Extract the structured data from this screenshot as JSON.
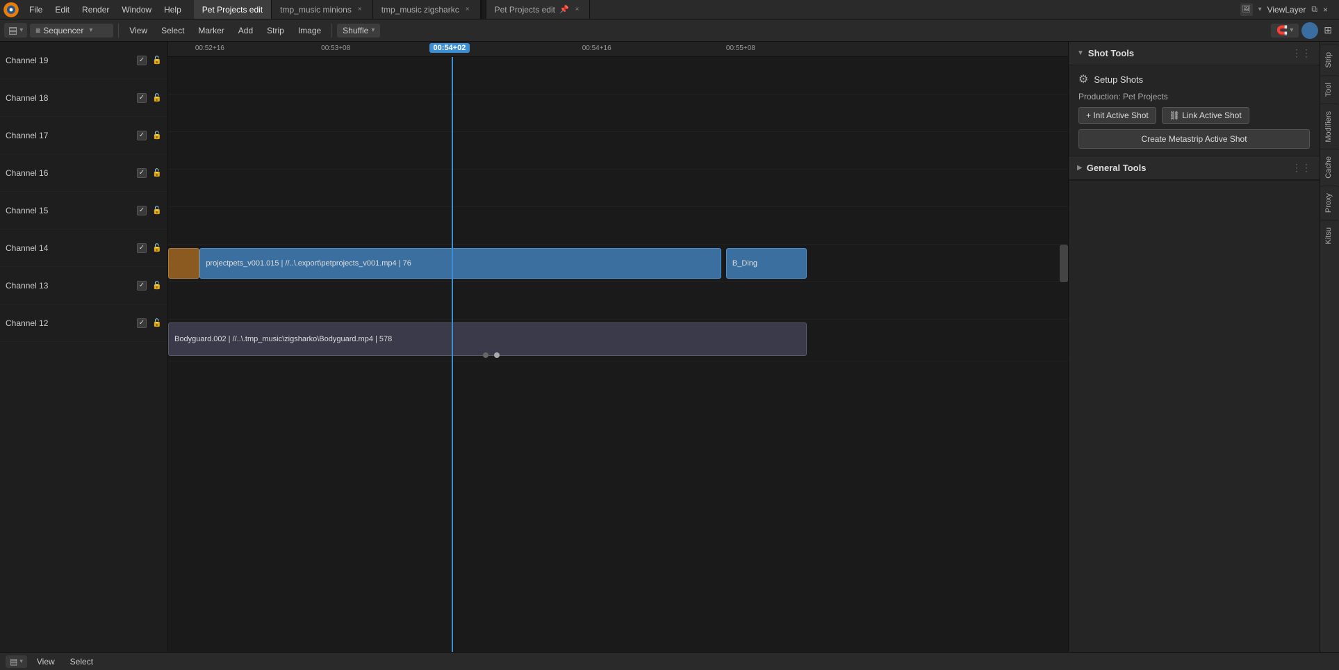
{
  "app": {
    "logo": "⬡",
    "menu": [
      "File",
      "Edit",
      "Render",
      "Window",
      "Help"
    ]
  },
  "tabs": [
    {
      "label": "Pet Projects edit",
      "active": true,
      "pinned": false
    },
    {
      "label": "tmp_music minions",
      "active": false,
      "pinned": false
    },
    {
      "label": "tmp_music zigsharkc",
      "active": false,
      "pinned": false
    },
    {
      "label": "Pet Projects edit",
      "active": false,
      "pinned": true,
      "separator": true
    }
  ],
  "viewlayer": {
    "label": "ViewLayer"
  },
  "toolbar": {
    "workspace_icon": "▤",
    "sequencer_label": "Sequencer",
    "view_label": "View",
    "select_label": "Select",
    "marker_label": "Marker",
    "add_label": "Add",
    "strip_label": "Strip",
    "image_label": "Image",
    "shuffle_label": "Shuffle",
    "shuffle_arrow": "▾"
  },
  "channels": [
    {
      "name": "Channel 19",
      "checked": true
    },
    {
      "name": "Channel 18",
      "checked": true
    },
    {
      "name": "Channel 17",
      "checked": true
    },
    {
      "name": "Channel 16",
      "checked": true
    },
    {
      "name": "Channel 15",
      "checked": true
    },
    {
      "name": "Channel 14",
      "checked": true
    },
    {
      "name": "Channel 13",
      "checked": true
    },
    {
      "name": "Channel 12",
      "checked": true
    }
  ],
  "timecodes": [
    {
      "label": "00:52+16",
      "left_pct": 3
    },
    {
      "label": "00:53+08",
      "left_pct": 17
    },
    {
      "label": "00:54+02",
      "left_pct": 30,
      "active": true
    },
    {
      "label": "00:54+16",
      "left_pct": 46
    },
    {
      "label": "00:55+08",
      "left_pct": 62
    }
  ],
  "playhead": {
    "time": "00:54+02",
    "left_pct": 30
  },
  "strips": [
    {
      "channel_index": 5,
      "type": "orange",
      "label": "",
      "left_pct": 0,
      "width_pct": 3.8
    },
    {
      "channel_index": 5,
      "type": "blue",
      "label": "projectpets_v001.015 | //..\\.export\\petprojects_v001.mp4 | 76",
      "left_pct": 3.8,
      "width_pct": 60
    },
    {
      "channel_index": 5,
      "type": "blue-right",
      "label": "B_Ding",
      "left_pct": 64.5,
      "width_pct": 10
    },
    {
      "channel_index": 7,
      "type": "gray",
      "label": "Bodyguard.002 | //..\\.tmp_music\\zigsharko\\Bodyguard.mp4 | 578",
      "left_pct": 0,
      "width_pct": 100
    }
  ],
  "right_panel": {
    "shot_tools": {
      "title": "Shot Tools",
      "expanded": true,
      "setup_shots_label": "Setup Shots",
      "production_label": "Production: Pet Projects",
      "init_button": "+ Init Active Shot",
      "link_button": "⛓ Link Active Shot",
      "metastrip_button": "Create Metastrip Active Shot"
    },
    "general_tools": {
      "title": "General Tools",
      "expanded": false
    }
  },
  "side_tabs": [
    "Strip",
    "Tool",
    "Modifiers",
    "Cache",
    "Proxy",
    "Kitsu"
  ],
  "bottom_bar": {
    "workspace_icon": "▤",
    "view_label": "View",
    "select_label": "Select"
  },
  "scroll_dots": [
    {
      "active": false
    },
    {
      "active": false
    },
    {
      "active": true
    },
    {
      "active": false
    }
  ]
}
